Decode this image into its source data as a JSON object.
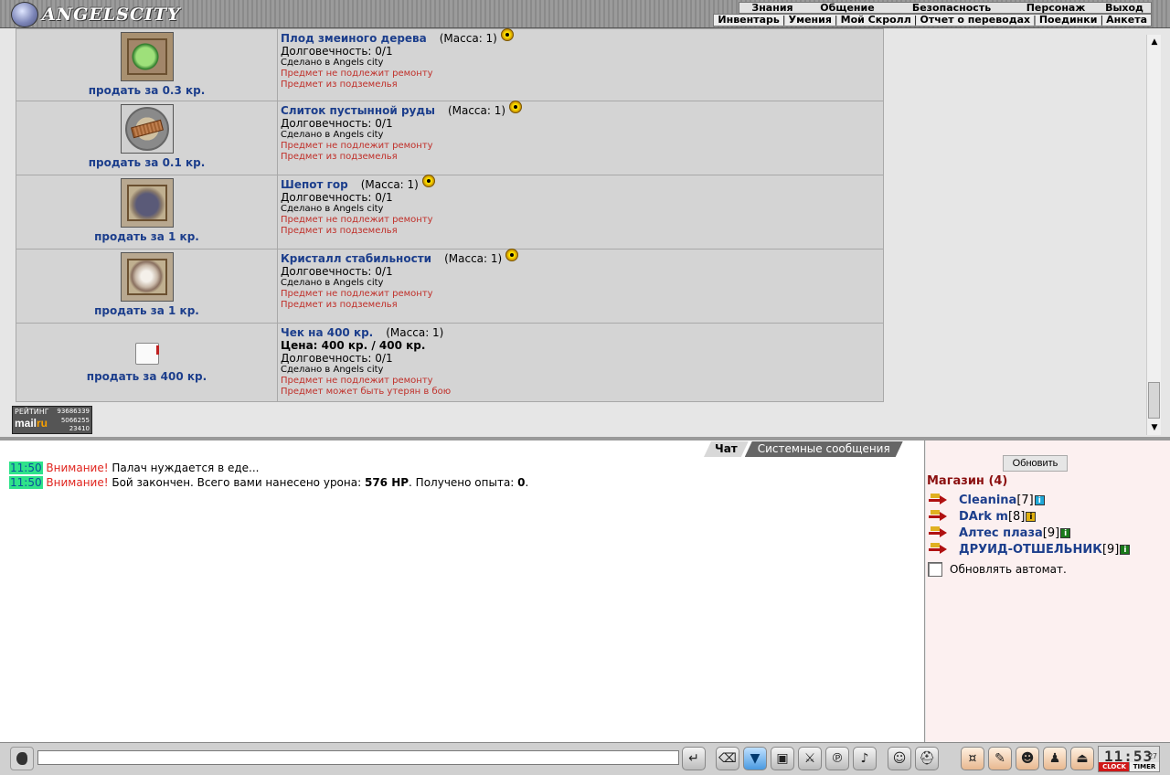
{
  "topbar": {
    "brand": "ANGELSCITY",
    "menu_main": [
      "Знания",
      "Общение",
      "Безопасность",
      "Персонаж",
      "Выход"
    ],
    "menu_sub": [
      "Инвентарь",
      "Умения",
      "Мой Скролл",
      "Отчет о переводах",
      "Поединки",
      "Анкета"
    ]
  },
  "items": [
    {
      "name": "Плод змеиного дерева",
      "mass": "(Масса: 1)",
      "radioactive": true,
      "price": "",
      "durability": "Долговечность: 0/1",
      "made": "Сделано в Angels city",
      "note1": "Предмет не подлежит ремонту",
      "note2": "Предмет из подземелья",
      "sell": "продать за 0.3 кр.",
      "icon": "green-fruit-icon"
    },
    {
      "name": "Слиток пустынной руды",
      "mass": "(Масса: 1)",
      "radioactive": true,
      "price": "",
      "durability": "Долговечность: 0/1",
      "made": "Сделано в Angels city",
      "note1": "Предмет не подлежит ремонту",
      "note2": "Предмет из подземелья",
      "sell": "продать за 0.1 кр.",
      "icon": "ore-ingot-icon"
    },
    {
      "name": "Шепот гор",
      "mass": "(Масса: 1)",
      "radioactive": true,
      "price": "",
      "durability": "Долговечность: 0/1",
      "made": "Сделано в Angels city",
      "note1": "Предмет не подлежит ремонту",
      "note2": "Предмет из подземелья",
      "sell": "продать за 1 кр.",
      "icon": "mountain-stone-icon"
    },
    {
      "name": "Кристалл стабильности",
      "mass": "(Масса: 1)",
      "radioactive": true,
      "price": "",
      "durability": "Долговечность: 0/1",
      "made": "Сделано в Angels city",
      "note1": "Предмет не подлежит ремонту",
      "note2": "Предмет из подземелья",
      "sell": "продать за 1 кр.",
      "icon": "crystal-orb-icon"
    },
    {
      "name": "Чек на 400 кр.",
      "mass": "(Масса: 1)",
      "radioactive": false,
      "price": "Цена: 400 кр. / 400 кр.",
      "durability": "Долговечность: 0/1",
      "made": "Сделано в Angels city",
      "note1": "Предмет не подлежит ремонту",
      "note2": "Предмет может быть утерян в бою",
      "sell": "продать за 400 кр.",
      "icon": "scroll-cheque-icon"
    }
  ],
  "rating": {
    "label": "РЕЙТИНГ",
    "n1": "93686339",
    "n2": "5066255",
    "n3": "23410",
    "brand_a": "mail",
    "brand_b": "ru"
  },
  "chat": {
    "tab_active": "Чат",
    "tab_system": "Системные сообщения",
    "messages": [
      {
        "time": "11:50",
        "warn": "Внимание!",
        "text": " Палач нуждается в еде..."
      },
      {
        "time": "11:50",
        "warn": "Внимание!",
        "text_a": " Бой закончен. Всего вами нанесено урона: ",
        "bold_a": "576 HP",
        "text_b": ". Получено опыта: ",
        "bold_b": "0",
        "text_c": "."
      }
    ]
  },
  "shop": {
    "refresh_label": "Обновить",
    "title": "Магазин (4)",
    "users": [
      {
        "name": "Cleanina",
        "level": "[7]",
        "info_color": "#1ea8d8"
      },
      {
        "name": "DArk m",
        "level": "[8]",
        "info_color": "#e0b010"
      },
      {
        "name": "Алтес плаза",
        "level": "[9]",
        "info_color": "#1a7a1a"
      },
      {
        "name": "ДРУИД-ОТШЕЛЬНИК",
        "level": "[9]",
        "info_color": "#1a7a1a"
      }
    ],
    "auto_label": "Обновлять автомат."
  },
  "bottombar": {
    "clock": "11:53",
    "seconds": "27",
    "clock_label": "CLOCK",
    "timer_label": "TIMER"
  }
}
